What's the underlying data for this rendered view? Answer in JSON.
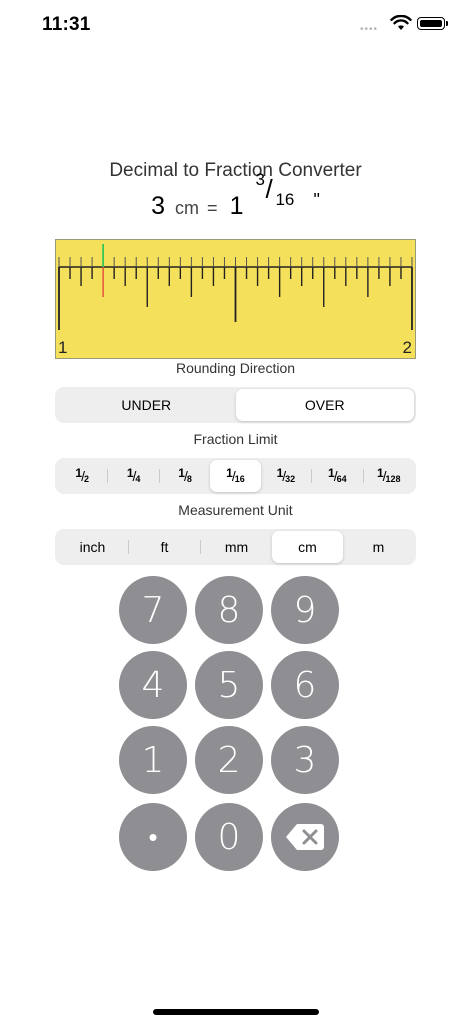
{
  "status_bar": {
    "time": "11:31",
    "dots": "••••"
  },
  "app": {
    "title": "Decimal to Fraction Converter"
  },
  "result": {
    "input_value": "3",
    "input_unit": "cm",
    "equals": "=",
    "whole": "1",
    "numerator": "3",
    "slash": "/",
    "denominator": "16",
    "output_unit": "\""
  },
  "ruler": {
    "start_label": "1",
    "end_label": "2",
    "divisions": 32,
    "current_tick": 4,
    "result_tick": 3,
    "current_color": "#e8473a",
    "result_color": "#34c759",
    "background": "#f5e05b"
  },
  "rounding": {
    "label": "Rounding Direction",
    "options": [
      "UNDER",
      "OVER"
    ],
    "selected": "OVER"
  },
  "fraction_limit": {
    "label": "Fraction Limit",
    "options": [
      {
        "num": "1",
        "den": "2"
      },
      {
        "num": "1",
        "den": "4"
      },
      {
        "num": "1",
        "den": "8"
      },
      {
        "num": "1",
        "den": "16"
      },
      {
        "num": "1",
        "den": "32"
      },
      {
        "num": "1",
        "den": "64"
      },
      {
        "num": "1",
        "den": "128"
      }
    ],
    "selected_index": 3
  },
  "measurement_unit": {
    "label": "Measurement Unit",
    "options": [
      "inch",
      "ft",
      "mm",
      "cm",
      "m"
    ],
    "selected": "cm"
  },
  "keypad": {
    "keys": [
      "7",
      "8",
      "9",
      "4",
      "5",
      "6",
      "1",
      "2",
      "3",
      "•",
      "0"
    ],
    "backspace_icon": "delete-backward-icon",
    "key_color": "#8e8e93"
  }
}
